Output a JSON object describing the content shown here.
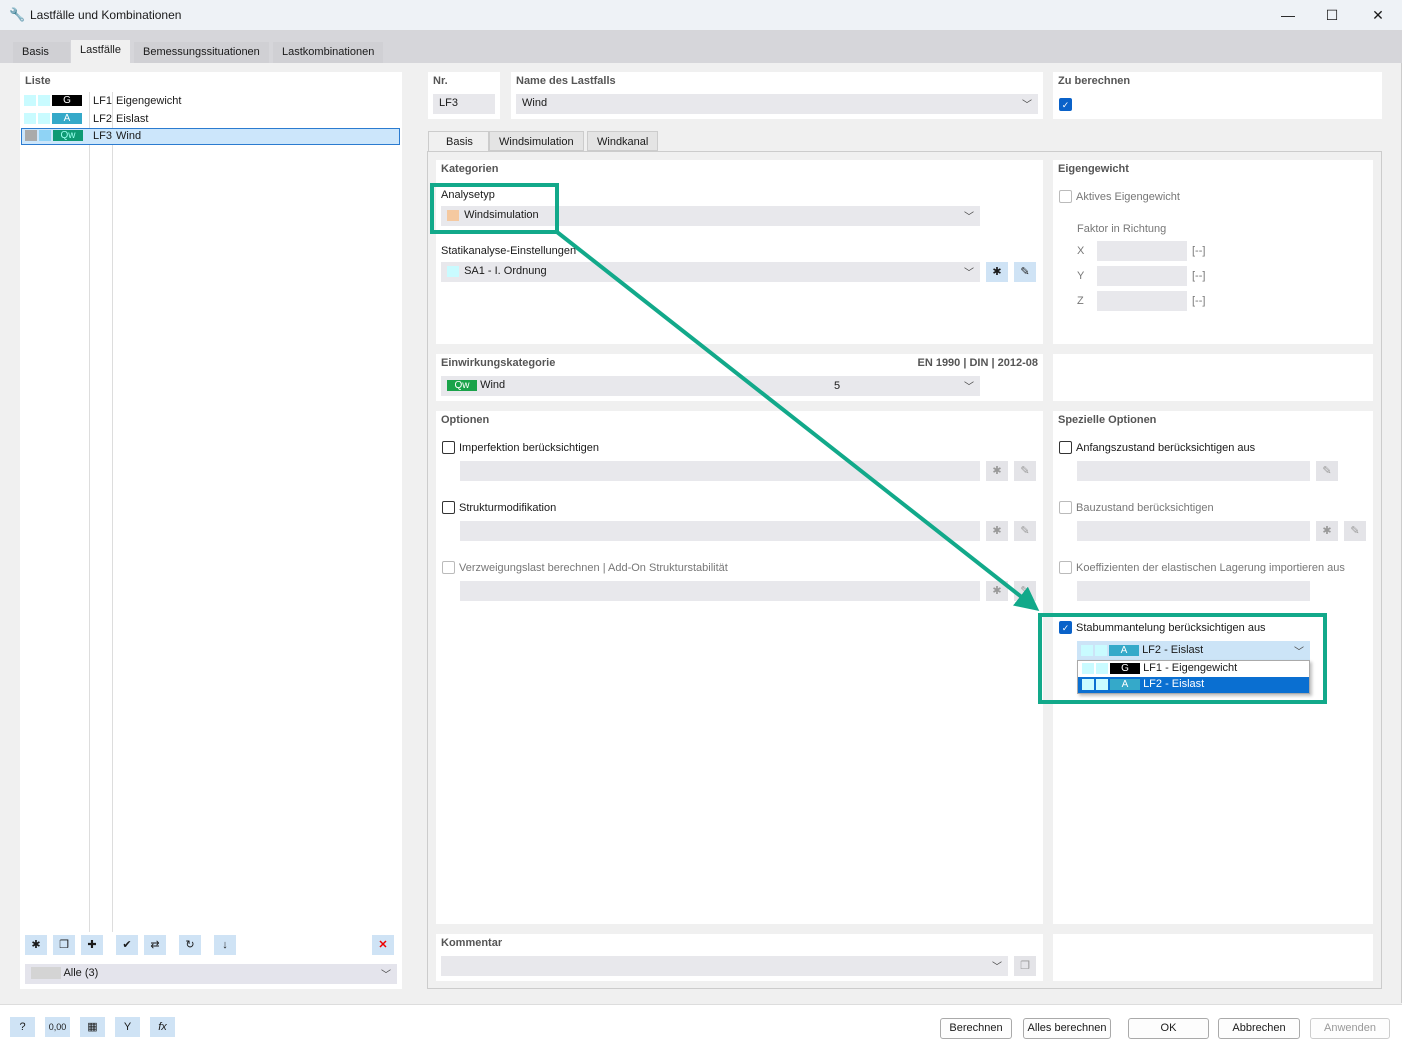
{
  "window": {
    "title": "Lastfälle und Kombinationen",
    "min": "—",
    "max": "☐",
    "close": "✕"
  },
  "tabs": [
    "Basis",
    "Lastfälle",
    "Bemessungssituationen",
    "Lastkombinationen"
  ],
  "list": {
    "label": "Liste",
    "items": [
      {
        "tag": "G",
        "tag_color": "#000000",
        "id": "LF1",
        "name": "Eigengewicht"
      },
      {
        "tag": "A",
        "tag_color": "#35a9c9",
        "id": "LF2",
        "name": "Eislast"
      },
      {
        "tag": "Qw",
        "tag_color": "#0e9a73",
        "id": "LF3",
        "name": "Wind",
        "selected": true
      }
    ],
    "filter": "Alle (3)"
  },
  "nr": {
    "label": "Nr.",
    "value": "LF3"
  },
  "name": {
    "label": "Name des Lastfalls",
    "value": "Wind"
  },
  "calc": {
    "label": "Zu berechnen",
    "checked": true
  },
  "subtabs": [
    "Basis",
    "Windsimulation",
    "Windkanal"
  ],
  "kategorien": {
    "label": "Kategorien",
    "analyse_label": "Analysetyp",
    "analyse_value": "Windsimulation",
    "statik_label": "Statikanalyse-Einstellungen",
    "statik_value": "SA1 - I. Ordnung"
  },
  "eigengewicht": {
    "label": "Eigengewicht",
    "active": "Aktives Eigengewicht",
    "factor": "Faktor in Richtung",
    "axes": [
      "X",
      "Y",
      "Z"
    ],
    "unit": "[--]"
  },
  "einwirkung": {
    "label": "Einwirkungskategorie",
    "norm": "EN 1990 | DIN | 2012-08",
    "tag": "Qw",
    "value": "Wind",
    "code": "5"
  },
  "optionen": {
    "label": "Optionen",
    "items": [
      "Imperfektion berücksichtigen",
      "Strukturmodifikation",
      "Verzweigungslast berechnen | Add-On Strukturstabilität"
    ]
  },
  "spezielle": {
    "label": "Spezielle Optionen",
    "items": [
      "Anfangszustand berücksichtigen aus",
      "Bauzustand berücksichtigen",
      "Koeffizienten der elastischen Lagerung importieren aus",
      "Stabummantelung berücksichtigen aus"
    ],
    "dropdown": {
      "value": "LF2 - Eislast",
      "value_tag": "A",
      "options": [
        {
          "tag": "G",
          "label": "LF1 - Eigengewicht"
        },
        {
          "tag": "A",
          "label": "LF2 - Eislast"
        }
      ]
    }
  },
  "kommentar": {
    "label": "Kommentar"
  },
  "buttons": {
    "calc": "Berechnen",
    "calc_all": "Alles berechnen",
    "ok": "OK",
    "cancel": "Abbrechen",
    "apply": "Anwenden"
  },
  "colors": {
    "annotation": "#12a98a",
    "accent": "#0a62c9"
  }
}
